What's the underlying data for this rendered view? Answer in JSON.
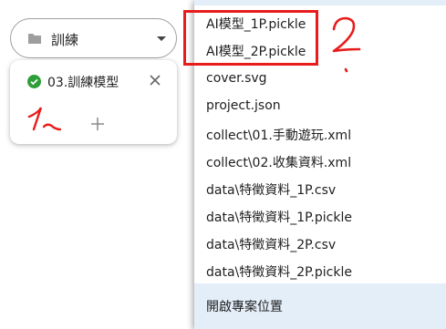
{
  "selector": {
    "label": "訓練",
    "icon": "folder-icon"
  },
  "tab": {
    "label": "03.訓練模型",
    "status_icon": "check-circle-icon",
    "close_icon": "close-icon",
    "add_icon": "plus-icon"
  },
  "menu": {
    "items": [
      "AI模型_1P.pickle",
      "AI模型_2P.pickle",
      "cover.svg",
      "project.json",
      "collect\\01.手動遊玩.xml",
      "collect\\02.收集資料.xml",
      "data\\特徵資料_1P.csv",
      "data\\特徵資料_1P.pickle",
      "data\\特徵資料_2P.csv",
      "data\\特徵資料_2P.pickle"
    ],
    "footer": "開啟專案位置"
  },
  "colors": {
    "accent_green": "#2e9e3a",
    "highlight_red": "#e81c1c",
    "menu_footer_bg": "#e3eef9"
  }
}
